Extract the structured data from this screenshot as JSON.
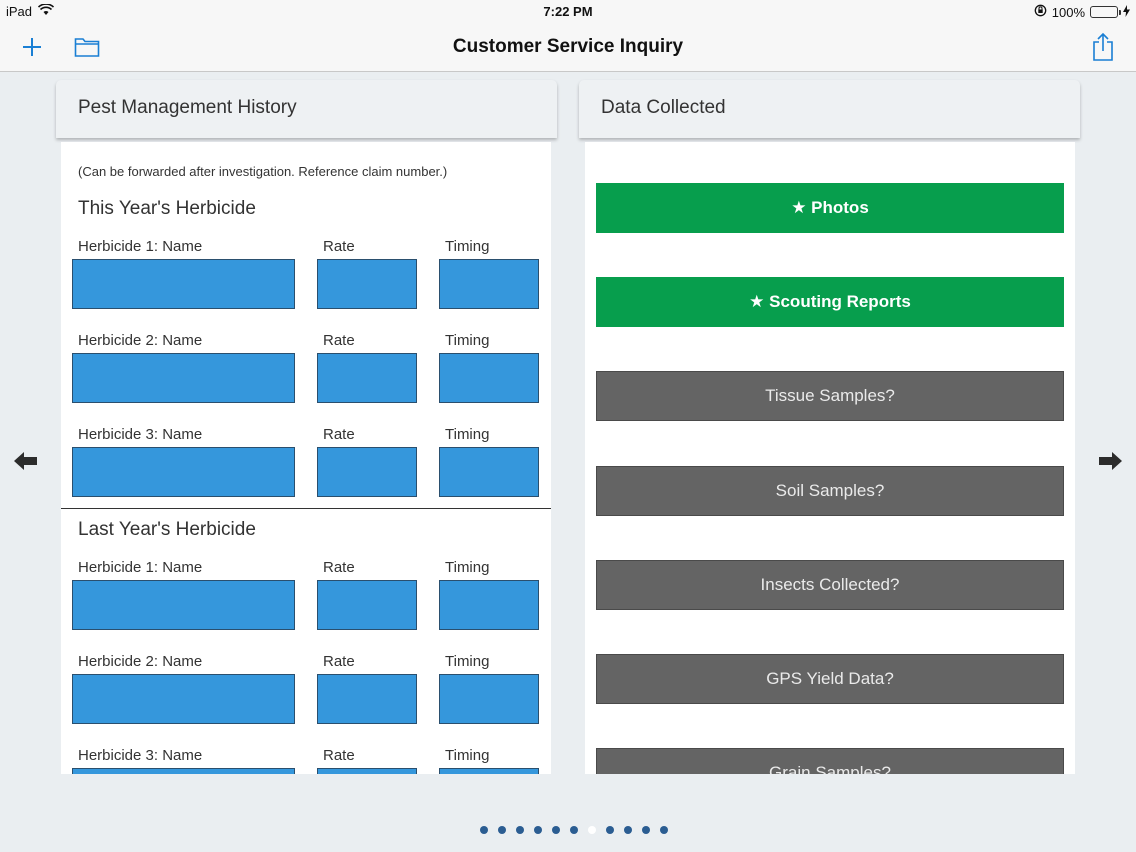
{
  "status_bar": {
    "device": "iPad",
    "time": "7:22 PM",
    "battery": "100%"
  },
  "nav": {
    "title": "Customer Service Inquiry"
  },
  "left_panel": {
    "title": "Pest Management History",
    "note": "(Can be forwarded after investigation. Reference claim number.)",
    "this_year": {
      "title": "This Year's Herbicide",
      "rows": [
        {
          "name_label": "Herbicide 1: Name",
          "rate_label": "Rate",
          "timing_label": "Timing"
        },
        {
          "name_label": "Herbicide 2: Name",
          "rate_label": "Rate",
          "timing_label": "Timing"
        },
        {
          "name_label": "Herbicide 3: Name",
          "rate_label": "Rate",
          "timing_label": "Timing"
        }
      ]
    },
    "last_year": {
      "title": "Last Year's Herbicide",
      "rows": [
        {
          "name_label": "Herbicide 1: Name",
          "rate_label": "Rate",
          "timing_label": "Timing"
        },
        {
          "name_label": "Herbicide 2: Name",
          "rate_label": "Rate",
          "timing_label": "Timing"
        },
        {
          "name_label": "Herbicide 3: Name",
          "rate_label": "Rate",
          "timing_label": "Timing"
        }
      ]
    }
  },
  "right_panel": {
    "title": "Data Collected",
    "buttons": [
      {
        "label": "★ Photos",
        "style": "green"
      },
      {
        "label": "★ Scouting Reports",
        "style": "green"
      },
      {
        "label": "Tissue Samples?",
        "style": "gray"
      },
      {
        "label": "Soil Samples?",
        "style": "gray"
      },
      {
        "label": "Insects Collected?",
        "style": "gray"
      },
      {
        "label": "GPS Yield Data?",
        "style": "gray"
      },
      {
        "label": "Grain Samples?",
        "style": "gray"
      }
    ]
  },
  "pager": {
    "count": 11,
    "active_index": 6
  },
  "colors": {
    "field": "#3597dc",
    "green_button": "#079e4d",
    "gray_button": "#646464",
    "accent": "#1a7fd4"
  }
}
